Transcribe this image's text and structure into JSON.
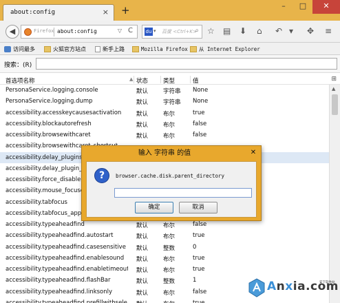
{
  "tab": {
    "title": "about:config",
    "close": "×",
    "new_tab": "+"
  },
  "window": {
    "minimize": "–",
    "maximize": "□",
    "close": "✕"
  },
  "navbar": {
    "identity_label": "Firefox",
    "url": "about:config",
    "url_dropdown": "▽",
    "reload": "C",
    "search_engine_icon": "paw-icon",
    "search_dropdown": "▾",
    "search_placeholder": "百度 <Ctrl+K>",
    "search_go": "⌕",
    "icons": [
      "star-icon",
      "clipboard-icon",
      "download-icon",
      "home-icon",
      "back-arrow-icon",
      "dropdown-icon",
      "menu-icon"
    ]
  },
  "bookmarks": [
    {
      "label": "访问最多",
      "icon": "gear"
    },
    {
      "label": "火狐官方站点",
      "icon": "folder"
    },
    {
      "label": "新手上路",
      "icon": "page"
    },
    {
      "label": "Mozilla Firefox",
      "icon": "folder"
    },
    {
      "label": "从 Internet Explorer",
      "icon": "folder"
    }
  ],
  "filter": {
    "label": "搜索：(R)"
  },
  "table": {
    "headers": {
      "name": "首选项名称",
      "status": "状态",
      "type": "类型",
      "value": "值"
    },
    "rows": [
      {
        "name": "PersonaService.logging.console",
        "status": "默认",
        "type": "字符串",
        "value": "None"
      },
      {
        "name": "PersonaService.logging.dump",
        "status": "默认",
        "type": "字符串",
        "value": "None"
      },
      {
        "name": "accessibility.accesskeycausesactivation",
        "status": "默认",
        "type": "布尔",
        "value": "true"
      },
      {
        "name": "accessibility.blockautorefresh",
        "status": "默认",
        "type": "布尔",
        "value": "false"
      },
      {
        "name": "accessibility.browsewithcaret",
        "status": "默认",
        "type": "布尔",
        "value": "false"
      },
      {
        "name": "accessibility.browsewithcaret_shortcut",
        "status": "",
        "type": "",
        "value": ""
      },
      {
        "name": "accessibility.delay_plugins",
        "status": "",
        "type": "",
        "value": ""
      },
      {
        "name": "accessibility.delay_plugin_time",
        "status": "",
        "type": "",
        "value": ""
      },
      {
        "name": "accessibility.force_disabled",
        "status": "",
        "type": "",
        "value": ""
      },
      {
        "name": "accessibility.mouse_focuses_formcontrol",
        "status": "",
        "type": "",
        "value": ""
      },
      {
        "name": "accessibility.tabfocus",
        "status": "",
        "type": "",
        "value": ""
      },
      {
        "name": "accessibility.tabfocus_applies_to_xul",
        "status": "",
        "type": "",
        "value": ""
      },
      {
        "name": "accessibility.typeaheadfind",
        "status": "默认",
        "type": "布尔",
        "value": "false"
      },
      {
        "name": "accessibility.typeaheadfind.autostart",
        "status": "默认",
        "type": "布尔",
        "value": "true"
      },
      {
        "name": "accessibility.typeaheadfind.casesensitive",
        "status": "默认",
        "type": "整数",
        "value": "0"
      },
      {
        "name": "accessibility.typeaheadfind.enablesound",
        "status": "默认",
        "type": "布尔",
        "value": "true"
      },
      {
        "name": "accessibility.typeaheadfind.enabletimeout",
        "status": "默认",
        "type": "布尔",
        "value": "true"
      },
      {
        "name": "accessibility.typeaheadfind.flashBar",
        "status": "默认",
        "type": "整数",
        "value": "1"
      },
      {
        "name": "accessibility.typeaheadfind.linksonly",
        "status": "默认",
        "type": "布尔",
        "value": "false"
      },
      {
        "name": "accessibility.typeaheadfind.prefillwithsele",
        "status": "默认",
        "type": "布尔",
        "value": "true"
      }
    ]
  },
  "dialog": {
    "title": "输入 字符串 的值",
    "close": "✕",
    "message": "browser.cache.disk.parent_directory",
    "input_value": "",
    "ok": "确定",
    "cancel": "取消"
  },
  "watermark": {
    "text": "Anxia.com",
    "sub": "安下软件站"
  },
  "colors": {
    "titlebar": "#e8b44a",
    "dialog_frame": "#e8a82d",
    "selected_row": "#dde8f5"
  }
}
